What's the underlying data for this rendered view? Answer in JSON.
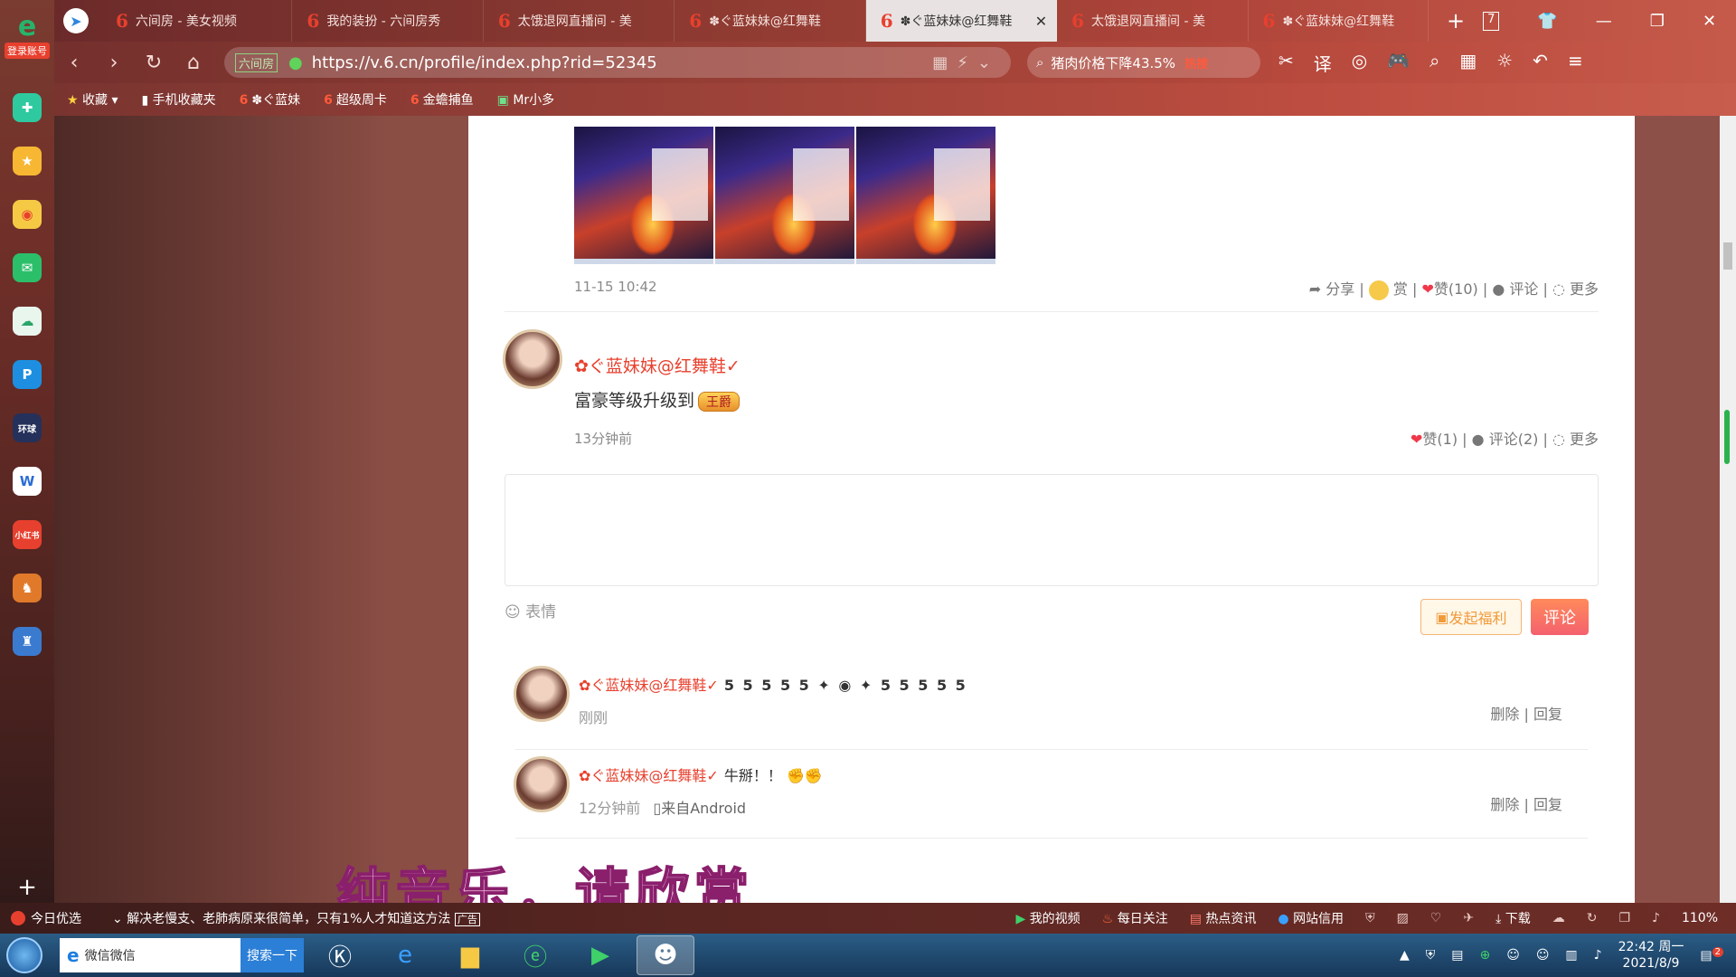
{
  "browser": {
    "sidebar_login": "登录账号",
    "tabs": [
      {
        "title": "六间房 - 美女视频",
        "active": false
      },
      {
        "title": "我的装扮 - 六间房秀",
        "active": false
      },
      {
        "title": "太饿退网直播间 - 美",
        "active": false
      },
      {
        "title": "✽ぐ蓝妹妹@红舞鞋",
        "active": false
      },
      {
        "title": "✽ぐ蓝妹妹@红舞鞋",
        "active": true
      },
      {
        "title": "太饿退网直播间 - 美",
        "active": false
      },
      {
        "title": "✽ぐ蓝妹妹@红舞鞋",
        "active": false
      }
    ],
    "tab_count": "7",
    "url": "https://v.6.cn/profile/index.php?rid=52345",
    "site_label": "六间房",
    "search_text": "猪肉价格下降43.5%",
    "search_hot": "热搜",
    "translate_label": "译",
    "bookmarks": [
      {
        "label": "收藏",
        "icon": "star-icon"
      },
      {
        "label": "手机收藏夹",
        "icon": "phone-icon"
      },
      {
        "label": "✽ぐ蓝妹",
        "icon": "six-icon"
      },
      {
        "label": "超级周卡",
        "icon": "six-icon"
      },
      {
        "label": "金蟾捕鱼",
        "icon": "six-icon"
      },
      {
        "label": "Mr小多",
        "icon": "green-icon"
      }
    ]
  },
  "feed": {
    "post1": {
      "time": "11-15 10:42",
      "share": "分享",
      "reward": "赏",
      "like": "赞(10)",
      "comment": "评论",
      "more": "更多"
    },
    "post2": {
      "user": "✿ぐ蓝妹妹@红舞鞋✓",
      "text": "富豪等级升级到",
      "badge": "王爵",
      "time": "13分钟前",
      "like": "赞(1)",
      "comment": "评论(2)",
      "more": "更多"
    },
    "composer": {
      "emoji": "表情",
      "fuli": "发起福利",
      "submit": "评论"
    },
    "replies": [
      {
        "user": "✿ぐ蓝妹妹@红舞鞋✓",
        "text": "5 5 5 5 5 ✦ ◉ ✦ 5 5 5 5 5",
        "time": "刚刚",
        "source": "",
        "delete": "删除",
        "reply": "回复"
      },
      {
        "user": "✿ぐ蓝妹妹@红舞鞋✓",
        "text": "牛掰！！",
        "time": "12分钟前",
        "source": "来自Android",
        "delete": "删除",
        "reply": "回复"
      }
    ]
  },
  "overlay": {
    "subtitle": "纯音乐，请欣赏"
  },
  "statusbar": {
    "left": "今日优选",
    "news": "解决老慢支、老肺病原来很简单，只有1%人才知道这方法",
    "ad": "广告",
    "items": [
      "我的视频",
      "每日关注",
      "热点资讯",
      "网站信用"
    ],
    "download": "下载",
    "zoom": "110%"
  },
  "taskbar": {
    "input_text": "微信微信",
    "search_button": "搜索一下",
    "time": "22:42 周一",
    "date": "2021/8/9",
    "notif_count": "2"
  },
  "colors": {
    "accent": "#e8402e",
    "comment_button": "#f4616e"
  }
}
